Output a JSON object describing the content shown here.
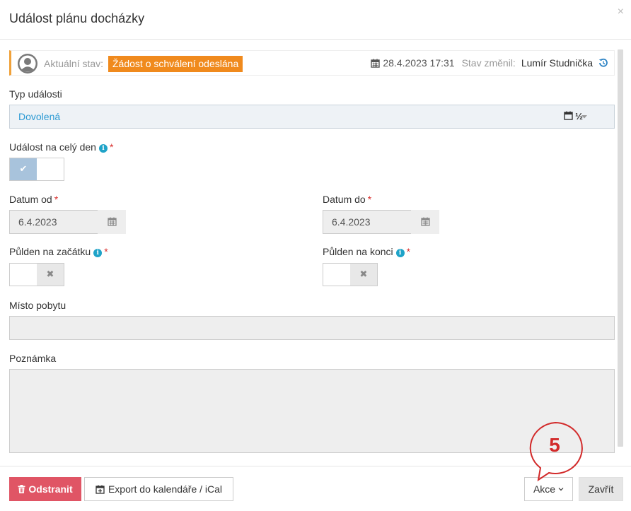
{
  "dialog": {
    "title": "Událost plánu docházky",
    "close_glyph": "×"
  },
  "status": {
    "label": "Aktuální stav:",
    "badge": "Žádost o schválení odeslána",
    "date": "28.4.2023 17:31",
    "changed_by_label": "Stav změnil:",
    "changed_by": "Lumír Studnička",
    "accent_color": "#f0a13a",
    "badge_color": "#f08a1d"
  },
  "form": {
    "event_type": {
      "label": "Typ události",
      "value": "Dovolená",
      "suffix": "½"
    },
    "all_day": {
      "label": "Událost na celý den",
      "required": "*",
      "checked": true
    },
    "date_from": {
      "label": "Datum od",
      "required": "*",
      "value": "6.4.2023"
    },
    "date_to": {
      "label": "Datum do",
      "required": "*",
      "value": "6.4.2023"
    },
    "half_day_start": {
      "label": "Půlden na začátku",
      "required": "*",
      "checked": false
    },
    "half_day_end": {
      "label": "Půlden na konci",
      "required": "*",
      "checked": false
    },
    "location": {
      "label": "Místo pobytu",
      "value": ""
    },
    "note": {
      "label": "Poznámka",
      "value": ""
    }
  },
  "footer": {
    "delete_label": "Odstranit",
    "export_label": "Export do kalendáře / iCal",
    "actions_label": "Akce",
    "close_label": "Zavřít"
  },
  "annotation": {
    "number": "5",
    "color": "#d22a2a"
  },
  "icons": {
    "avatar": "user-avatar-icon",
    "calendar": "calendar-icon",
    "history": "history-icon",
    "info": "info-icon",
    "check": "check-icon",
    "times": "times-icon",
    "trash": "trash-icon",
    "calendar_plus": "calendar-plus-icon",
    "chevron": "chevron-down-icon",
    "caret": "caret-down-icon"
  }
}
